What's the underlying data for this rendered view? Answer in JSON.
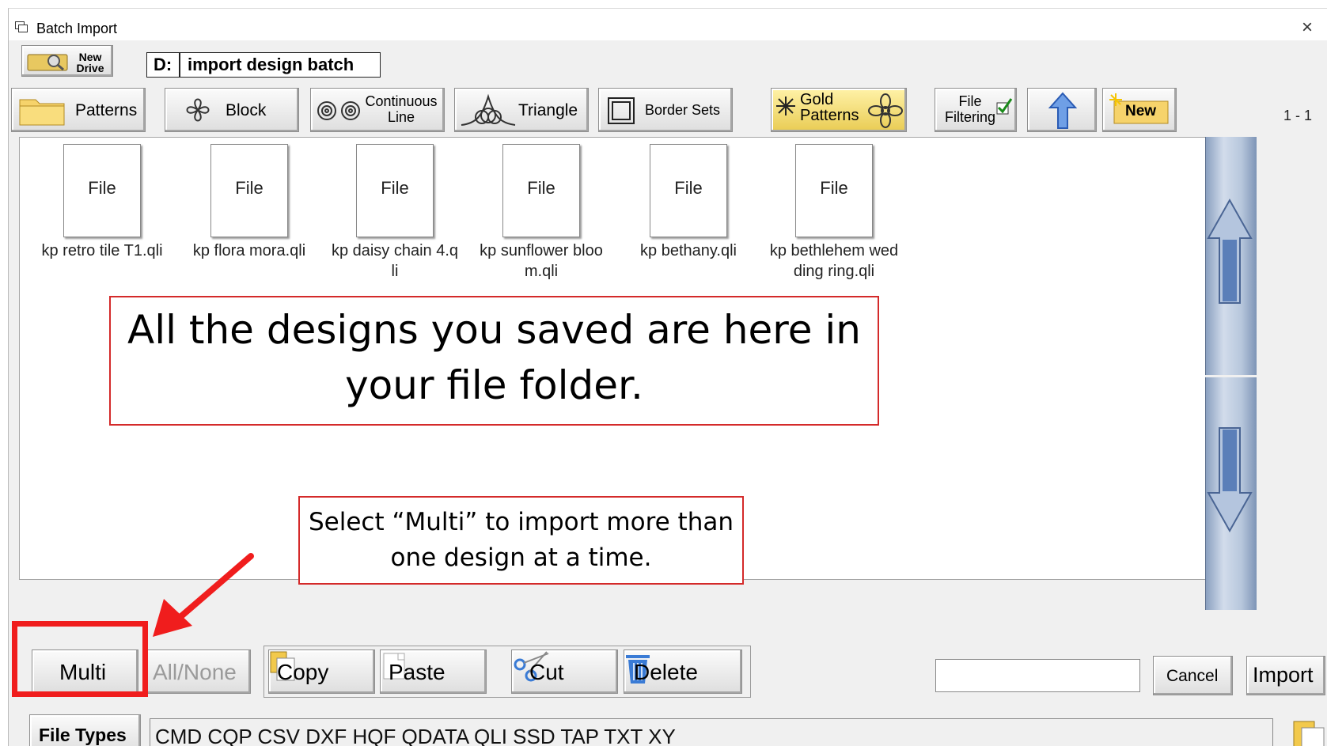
{
  "window": {
    "title": "Batch Import",
    "close_glyph": "×"
  },
  "drive": {
    "new_drive_line1": "New",
    "new_drive_line2": "Drive",
    "letter": "D:",
    "folder": "import design batch"
  },
  "toolbar": {
    "patterns": "Patterns",
    "block": "Block",
    "continuous_line_1": "Continuous",
    "continuous_line_2": "Line",
    "triangle": "Triangle",
    "border_sets": "Border Sets",
    "gold_patterns_1": "Gold",
    "gold_patterns_2": "Patterns",
    "file_filtering_1": "File",
    "file_filtering_2": "Filtering",
    "new": "New",
    "page_count": "1 - 1"
  },
  "files": [
    {
      "icon_label": "File",
      "name": "kp retro tile T1.qli"
    },
    {
      "icon_label": "File",
      "name": "kp flora mora.qli"
    },
    {
      "icon_label": "File",
      "name": "kp daisy chain 4.qli"
    },
    {
      "icon_label": "File",
      "name": "kp sunflower bloom.qli"
    },
    {
      "icon_label": "File",
      "name": "kp bethany.qli"
    },
    {
      "icon_label": "File",
      "name": "kp bethlehem wedding ring.qli"
    }
  ],
  "callouts": {
    "designs_saved": "All the designs you saved are here in your file folder.",
    "multi_hint": "Select “Multi” to import more than one design at a time."
  },
  "actions": {
    "multi": "Multi",
    "all_none": "All/None",
    "copy": "Copy",
    "paste": "Paste",
    "cut": "Cut",
    "delete": "Delete",
    "cancel": "Cancel",
    "import": "Import",
    "name_value": ""
  },
  "file_types": {
    "label": "File Types",
    "list": "CMD  CQP  CSV  DXF  HQF  QDATA  QLI  SSD  TAP  TXT  XY"
  },
  "colors": {
    "callout_border": "#d42a2a",
    "highlight": "#f01d1d",
    "gold": "#e9cc54",
    "scroll_blue": "#8aa0c0"
  }
}
